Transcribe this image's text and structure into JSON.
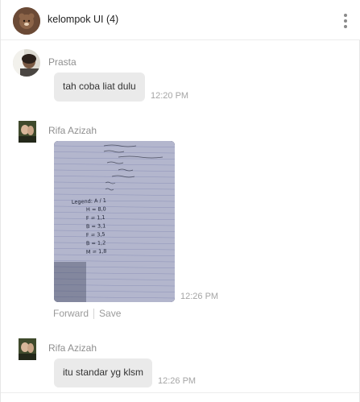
{
  "chat": {
    "title": "kelompok UI (4)",
    "icons": {
      "menu": "more-vertical-icon"
    },
    "colors": {
      "bubble": "#eaeaea",
      "sender": "#8f8f8f",
      "time": "#a5a5a5"
    }
  },
  "messages": [
    {
      "sender": "Prasta",
      "text": "tah coba liat dulu",
      "time": "12:20 PM"
    },
    {
      "sender": "Rifa Azizah",
      "time": "12:26 PM",
      "photo_lines": [
        "Legend: A / 1",
        "H = 8,0",
        "F = 1,1",
        "B = 3,1",
        "F = 3,5",
        "B = 1,2",
        "M = 1,8"
      ],
      "actions": {
        "forward": "Forward",
        "save": "Save"
      }
    },
    {
      "sender": "Rifa Azizah",
      "text": "itu standar yg klsm",
      "time": "12:26 PM"
    }
  ]
}
